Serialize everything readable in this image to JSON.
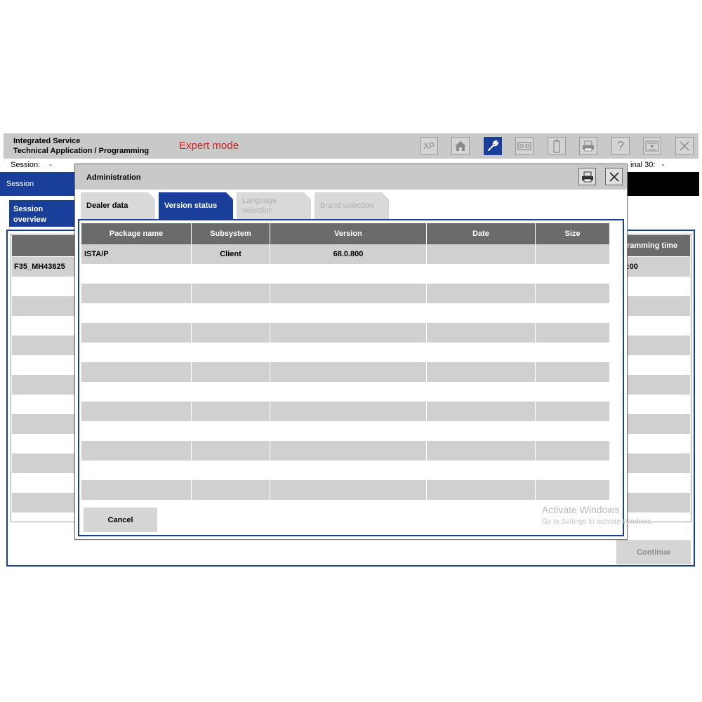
{
  "app": {
    "title_line1": "Integrated Service",
    "title_line2": "Technical Application / Programming",
    "mode": "Expert mode"
  },
  "toolbar": {
    "xp_label": "XP",
    "icons": [
      "home-icon",
      "wrench-icon",
      "battery-switch-icon",
      "battery-icon",
      "printer-icon",
      "help-icon",
      "download-icon",
      "close-icon"
    ]
  },
  "status": {
    "session_label": "Session:",
    "session_value": "-",
    "terminal_label": "inal 30:",
    "terminal_value": "-"
  },
  "nav": {
    "session": "Session",
    "session_overview_line1": "Session",
    "session_overview_line2": "overview"
  },
  "background_table": {
    "header_partial": "ramming time",
    "vehicle": "F35_MH43625",
    "time_partial": ":00"
  },
  "continue_label": "Continue",
  "dialog": {
    "title": "Administration",
    "tabs": [
      {
        "label": "Dealer data",
        "state": "normal"
      },
      {
        "label": "Version status",
        "state": "active"
      },
      {
        "label": "Language selection",
        "state": "disabled"
      },
      {
        "label": "Brand selection",
        "state": "disabled"
      }
    ],
    "columns": [
      "Package name",
      "Subsystem",
      "Version",
      "Date",
      "Size"
    ],
    "rows": [
      [
        "ISTA/P",
        "Client",
        "68.0.800",
        "",
        ""
      ]
    ],
    "cancel_label": "Cancel"
  },
  "watermark": {
    "line1": "Activate Windows",
    "line2": "Go to Settings to activate Windows."
  },
  "colors": {
    "accent": "#1a3f9a",
    "expert_mode": "#d02020",
    "header_grey": "#6b6b6b",
    "row_grey": "#d0d0d0"
  }
}
